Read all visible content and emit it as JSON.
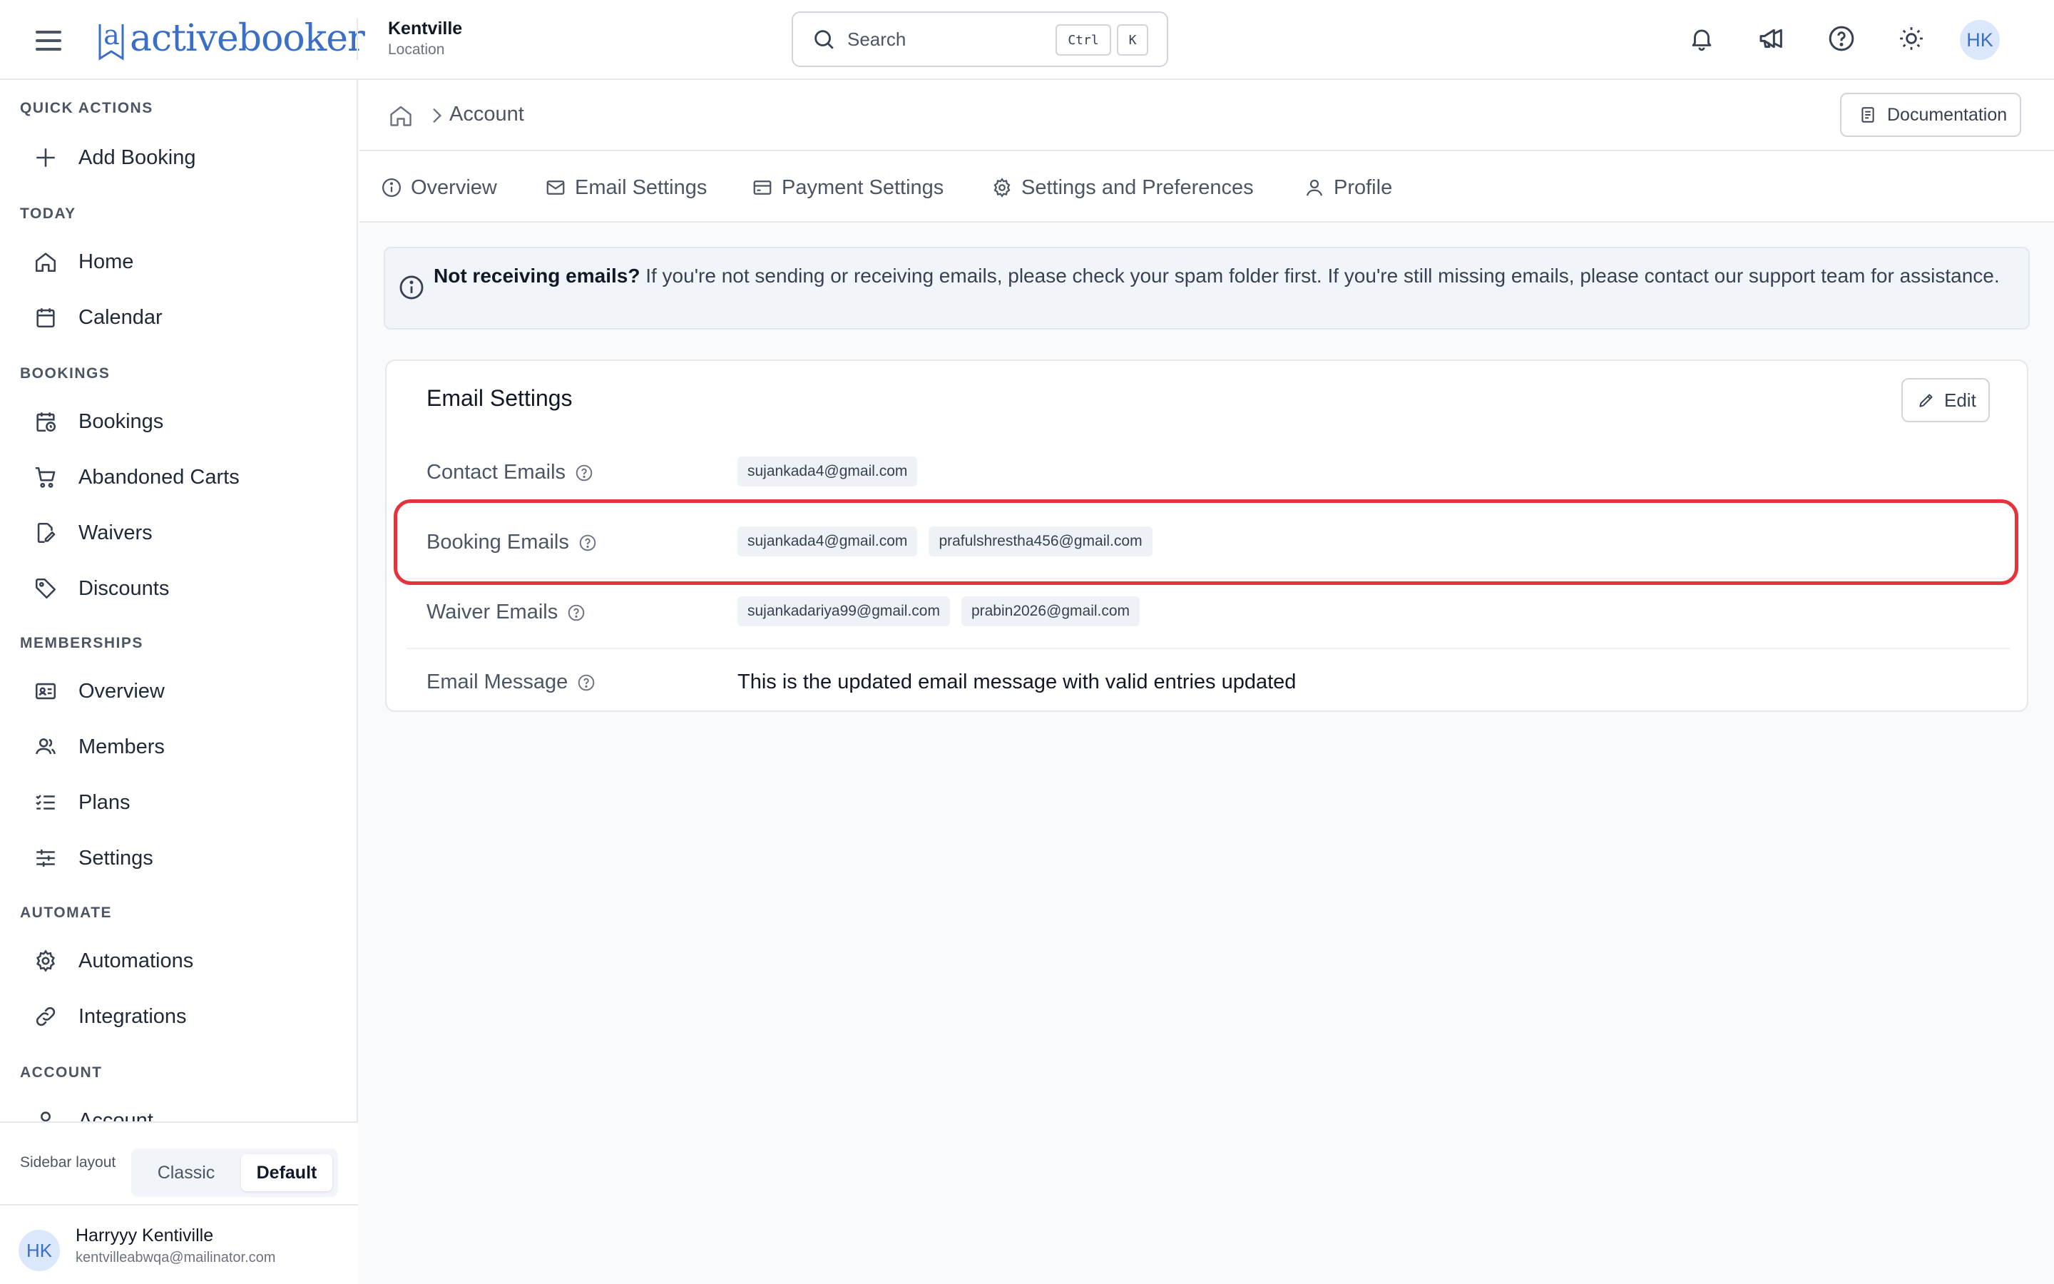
{
  "topbar": {
    "logo_text": "activebooker",
    "location_name": "Kentville",
    "location_sub": "Location",
    "search_placeholder": "Search",
    "kbd_ctrl": "Ctrl",
    "kbd_k": "K",
    "avatar_initials": "HK"
  },
  "sidebar": {
    "sections": {
      "quick_actions": "QUICK ACTIONS",
      "today": "TODAY",
      "bookings": "BOOKINGS",
      "memberships": "MEMBERSHIPS",
      "automate": "AUTOMATE",
      "account": "ACCOUNT"
    },
    "items": {
      "add_booking": "Add Booking",
      "home": "Home",
      "calendar": "Calendar",
      "bookings": "Bookings",
      "abandoned_carts": "Abandoned Carts",
      "waivers": "Waivers",
      "discounts": "Discounts",
      "overview": "Overview",
      "members": "Members",
      "plans": "Plans",
      "settings": "Settings",
      "automations": "Automations",
      "integrations": "Integrations",
      "account": "Account"
    },
    "layout_label": "Sidebar layout",
    "layout_options": {
      "classic": "Classic",
      "default": "Default"
    },
    "layout_selected": "Default",
    "user": {
      "initials": "HK",
      "name": "Harryyy Kentiville",
      "email": "kentvilleabwqa@mailinator.com"
    }
  },
  "breadcrumb": {
    "current": "Account",
    "documentation_label": "Documentation"
  },
  "tabs": {
    "overview": "Overview",
    "email_settings": "Email Settings",
    "payment_settings": "Payment Settings",
    "settings_preferences": "Settings and Preferences",
    "profile": "Profile"
  },
  "banner": {
    "title": "Not receiving emails?",
    "body": " If you're not sending or receiving emails, please check your spam folder first. If you're still missing emails, please contact our support team for assistance."
  },
  "email_settings": {
    "title": "Email Settings",
    "edit_label": "Edit",
    "contact_label": "Contact Emails",
    "contact_emails": [
      "sujankada4@gmail.com"
    ],
    "booking_label": "Booking Emails",
    "booking_emails": [
      "sujankada4@gmail.com",
      "prafulshrestha456@gmail.com"
    ],
    "waiver_label": "Waiver Emails",
    "waiver_emails": [
      "sujankadariya99@gmail.com",
      "prabin2026@gmail.com"
    ],
    "message_label": "Email Message",
    "message_value": "This is the updated email message with valid entries updated"
  },
  "colors": {
    "brand": "#3b6fc7",
    "highlight": "#e5323b"
  }
}
